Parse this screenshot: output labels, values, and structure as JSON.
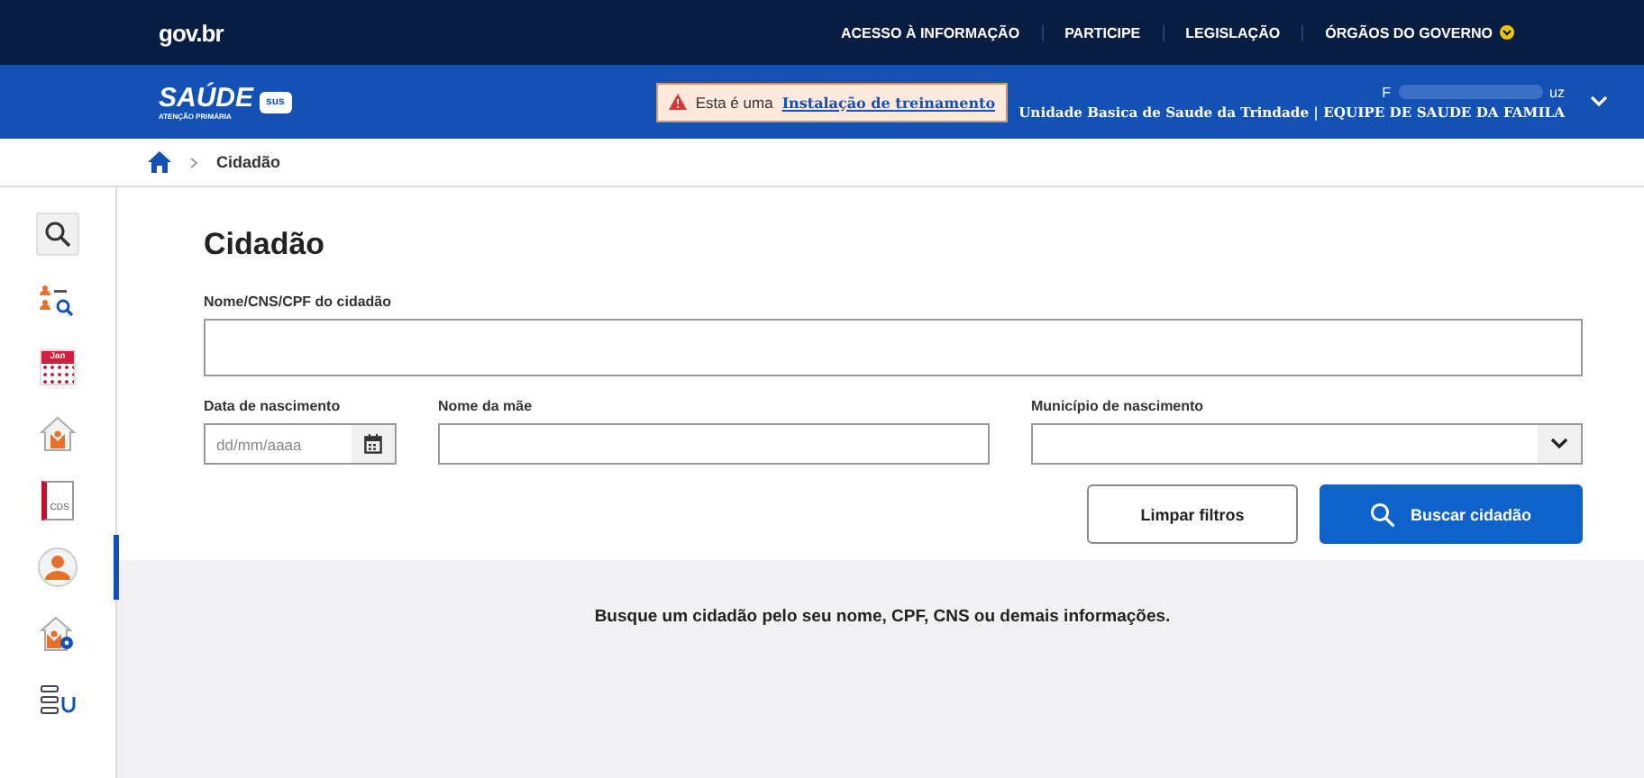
{
  "gov_bar": {
    "logo": "gov.br",
    "links": [
      {
        "label": "ACESSO À INFORMAÇÃO",
        "kind": "link"
      },
      {
        "label": "PARTICIPE",
        "kind": "link"
      },
      {
        "label": "LEGISLAÇÃO",
        "kind": "link"
      },
      {
        "label": "ÓRGÃOS DO GOVERNO",
        "kind": "dropdown"
      }
    ]
  },
  "header": {
    "logo_title": "SAÚDE",
    "logo_subtitle": "ATENÇÃO PRIMÁRIA",
    "logo_badge": "sus",
    "notice_text": "Esta é uma",
    "notice_link": "Instalação de treinamento",
    "user_name_start": "F",
    "user_name_end": "uz",
    "unit": "Unidade Basica de Saude da Trindade | EQUIPE DE SAUDE DA FAMILA"
  },
  "breadcrumb": {
    "current": "Cidadão"
  },
  "sidebar": {
    "items": [
      {
        "kind": "search",
        "selected": false
      },
      {
        "kind": "people-search",
        "selected": false
      },
      {
        "kind": "calendar",
        "label": "Jan",
        "selected": false
      },
      {
        "kind": "home-person",
        "selected": false
      },
      {
        "kind": "document",
        "label": "CDS",
        "selected": false
      },
      {
        "kind": "person",
        "selected": true
      },
      {
        "kind": "home-gear",
        "selected": false
      },
      {
        "kind": "list-stethoscope",
        "selected": false
      }
    ]
  },
  "page": {
    "title": "Cidadão",
    "fields": [
      {
        "label": "Nome/CNS/CPF do cidadão",
        "kind": "text"
      },
      {
        "label": "Data de nascimento",
        "kind": "date",
        "placeholder": "dd/mm/aaaa"
      },
      {
        "label": "Nome da mãe",
        "kind": "text"
      },
      {
        "label": "Município de nascimento",
        "kind": "select"
      }
    ],
    "buttons": [
      {
        "label": "Limpar filtros",
        "kind": "secondary"
      },
      {
        "label": "Buscar cidadão",
        "kind": "primary"
      }
    ],
    "empty_message": "Busque um cidadão pelo seu nome, CPF, CNS ou demais informações."
  }
}
